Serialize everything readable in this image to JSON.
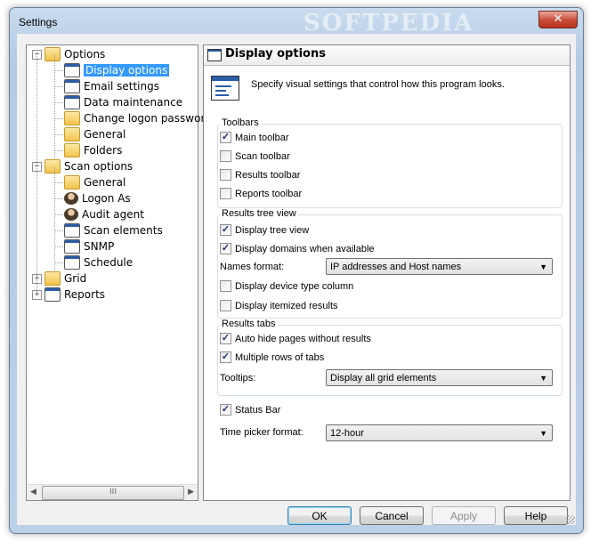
{
  "window": {
    "title": "Settings",
    "watermark": "SOFTPEDIA",
    "close_label": "✕"
  },
  "tree": {
    "items": [
      {
        "label": "Options",
        "level": 0,
        "expander": "−",
        "icon": "folder-icon"
      },
      {
        "label": "Display options",
        "level": 1,
        "icon": "display-window-icon",
        "selected": true
      },
      {
        "label": "Email settings",
        "level": 1,
        "icon": "email-icon"
      },
      {
        "label": "Data maintenance",
        "level": 1,
        "icon": "database-icon"
      },
      {
        "label": "Change logon password",
        "level": 1,
        "icon": "lock-icon"
      },
      {
        "label": "General",
        "level": 1,
        "icon": "general-settings-icon"
      },
      {
        "label": "Folders",
        "level": 1,
        "icon": "folder-icon"
      },
      {
        "label": "Scan options",
        "level": 0,
        "expander": "−",
        "icon": "folder-icon"
      },
      {
        "label": "General",
        "level": 1,
        "icon": "general-settings-icon"
      },
      {
        "label": "Logon As",
        "level": 1,
        "icon": "user-icon"
      },
      {
        "label": "Audit agent",
        "level": 1,
        "icon": "agent-icon"
      },
      {
        "label": "Scan elements",
        "level": 1,
        "icon": "checklist-icon"
      },
      {
        "label": "SNMP",
        "level": 1,
        "icon": "network-icon"
      },
      {
        "label": "Schedule",
        "level": 1,
        "icon": "calendar-icon"
      },
      {
        "label": "Grid",
        "level": 0,
        "expander": "+",
        "icon": "folder-icon"
      },
      {
        "label": "Reports",
        "level": 0,
        "expander": "+",
        "icon": "reports-icon"
      }
    ],
    "scroll_thumb": "III",
    "scroll_left": "◀",
    "scroll_right": "▶"
  },
  "panel": {
    "title": "Display options",
    "description": "Specify visual settings that control how this program looks.",
    "toolbars": {
      "title": "Toolbars",
      "items": [
        {
          "label": "Main toolbar",
          "checked": true
        },
        {
          "label": "Scan toolbar",
          "checked": false
        },
        {
          "label": "Results toolbar",
          "checked": false
        },
        {
          "label": "Reports toolbar",
          "checked": false
        }
      ]
    },
    "tree_view": {
      "title": "Results tree view",
      "display_tree": {
        "label": "Display tree view",
        "checked": true
      },
      "display_domains": {
        "label": "Display domains when available",
        "checked": true
      },
      "names_format_label": "Names format:",
      "names_format_value": "IP addresses and Host names",
      "device_type": {
        "label": "Display device type column",
        "checked": false
      },
      "itemized": {
        "label": "Display itemized results",
        "checked": false
      }
    },
    "results_tabs": {
      "title": "Results tabs",
      "auto_hide": {
        "label": "Auto hide pages without results",
        "checked": true
      },
      "multiple_rows": {
        "label": "Multiple rows of tabs",
        "checked": true
      },
      "tooltips_label": "Tooltips:",
      "tooltips_value": "Display all grid elements"
    },
    "status_bar": {
      "label": "Status Bar",
      "checked": true
    },
    "time_picker_label": "Time picker format:",
    "time_picker_value": "12-hour",
    "caret": "▼"
  },
  "buttons": {
    "ok": "OK",
    "cancel": "Cancel",
    "apply": "Apply",
    "help": "Help"
  },
  "check_mark": "✓"
}
